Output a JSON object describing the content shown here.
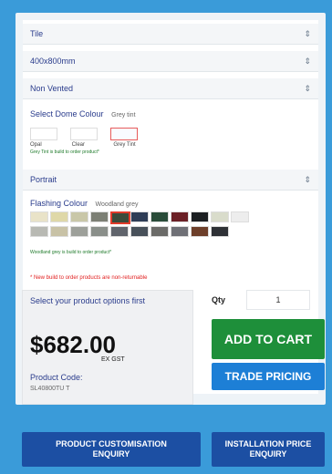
{
  "selects": {
    "type": "Tile",
    "size": "400x800mm",
    "vented": "Non Vented",
    "orientation": "Portrait",
    "chevron": "⇕"
  },
  "dome": {
    "title": "Select Dome Colour",
    "selected": "Grey tint",
    "options": [
      "Opal",
      "Clear",
      "Grey Tint"
    ],
    "note": "Grey Tint is build to order product*"
  },
  "flashing": {
    "title": "Flashing Colour",
    "selected": "Woodland grey",
    "note": "Woodland grey is build to order product*",
    "swatch_colors": [
      "#e9e3c8",
      "#dfd8a8",
      "#c9c7a8",
      "#7c7f74",
      "#3b4a3a",
      "#2e3d56",
      "#2a4c39",
      "#6b2026",
      "#1c1f22",
      "#d9dccb",
      "#ededed",
      "#b8b9b3",
      "#c8c2a6",
      "#9da09a",
      "#8a8f8a",
      "#60646c",
      "#48515a",
      "#6b6b68",
      "#6f7076",
      "#6d3f2a",
      "#2e3136"
    ]
  },
  "hint": "* New build to order products are non-returnable",
  "price_box": {
    "options_text": "Select your product options first",
    "price": "$682.00",
    "ex_gst": "EX GST",
    "code_label": "Product Code:",
    "code": "SL40800TU T"
  },
  "qty": {
    "label": "Qty",
    "value": "1"
  },
  "buttons": {
    "add_to_cart": "ADD TO CART",
    "trade_pricing": "TRADE PRICING",
    "customisation": "PRODUCT CUSTOMISATION\nENQUIRY",
    "installation": "INSTALLATION PRICE\nENQUIRY"
  },
  "colors": {
    "accent_green": "#1e8f3a",
    "accent_blue": "#1d7fd6",
    "enquiry_blue": "#1c4fa3"
  }
}
